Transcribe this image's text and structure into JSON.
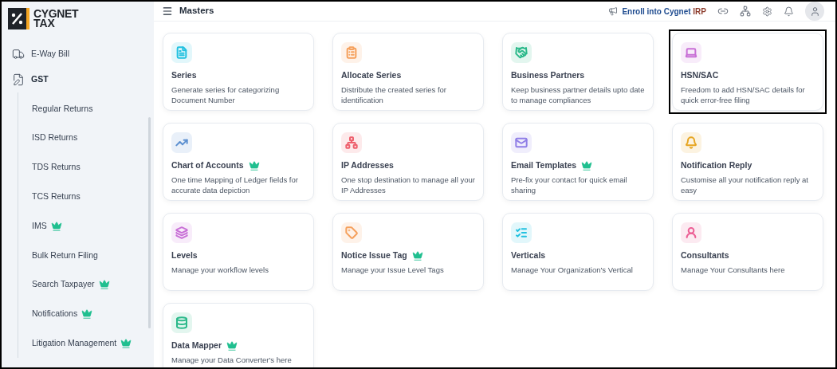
{
  "logo": {
    "line1": "CYGNET",
    "line2": "TAX"
  },
  "sidebar": {
    "items": [
      {
        "label": "E-Way Bill",
        "expanded": false
      },
      {
        "label": "GST",
        "expanded": true,
        "children": [
          {
            "label": "Regular Returns",
            "premium": false
          },
          {
            "label": "ISD Returns",
            "premium": false
          },
          {
            "label": "TDS Returns",
            "premium": false
          },
          {
            "label": "TCS Returns",
            "premium": false
          },
          {
            "label": "IMS",
            "premium": true
          },
          {
            "label": "Bulk Return Filing",
            "premium": false
          },
          {
            "label": "Search Taxpayer",
            "premium": true
          },
          {
            "label": "Notifications",
            "premium": true
          },
          {
            "label": "Litigation Management",
            "premium": true
          }
        ]
      }
    ]
  },
  "header": {
    "title": "Masters",
    "enroll_link": {
      "text": "Enroll into Cygnet",
      "accent": "IRP"
    }
  },
  "cards": [
    {
      "title": "Series",
      "description": "Generate series for categorizing Document Number",
      "premium": false,
      "highlighted": false,
      "color": "#22c1e0"
    },
    {
      "title": "Allocate Series",
      "description": "Distribute the created series for identification",
      "premium": false,
      "highlighted": false,
      "color": "#f5a05c"
    },
    {
      "title": "Business Partners",
      "description": "Keep business partner details upto date to manage compliances",
      "premium": false,
      "highlighted": false,
      "color": "#2bb98a"
    },
    {
      "title": "HSN/SAC",
      "description": "Freedom to add HSN/SAC details for quick error-free filing",
      "premium": false,
      "highlighted": true,
      "color": "#c86fd6"
    },
    {
      "title": "Chart of Accounts",
      "description": "One time Mapping of Ledger fields for accurate data depiction",
      "premium": true,
      "highlighted": false,
      "color": "#5b8fd0"
    },
    {
      "title": "IP Addresses",
      "description": "One stop destination to manage all your IP Addresses",
      "premium": false,
      "highlighted": false,
      "color": "#ee5f6c"
    },
    {
      "title": "Email Templates",
      "description": "Pre-fix your contact for quick email sharing",
      "premium": true,
      "highlighted": false,
      "color": "#8f7ee6"
    },
    {
      "title": "Notification Reply",
      "description": "Customise all your notification reply at easy",
      "premium": false,
      "highlighted": false,
      "color": "#e6a521"
    },
    {
      "title": "Levels",
      "description": "Manage your workflow levels",
      "premium": false,
      "highlighted": false,
      "color": "#c86fd6"
    },
    {
      "title": "Notice Issue Tag",
      "description": "Manage your Issue Level Tags",
      "premium": true,
      "highlighted": false,
      "color": "#f5a05c"
    },
    {
      "title": "Verticals",
      "description": "Manage Your Organization's Vertical",
      "premium": false,
      "highlighted": false,
      "color": "#22c1e0"
    },
    {
      "title": "Consultants",
      "description": "Manage Your Consultants here",
      "premium": false,
      "highlighted": false,
      "color": "#ec5f95"
    },
    {
      "title": "Data Mapper",
      "description": "Manage your Data Converter's here",
      "premium": true,
      "highlighted": false,
      "color": "#2bb98a"
    }
  ]
}
